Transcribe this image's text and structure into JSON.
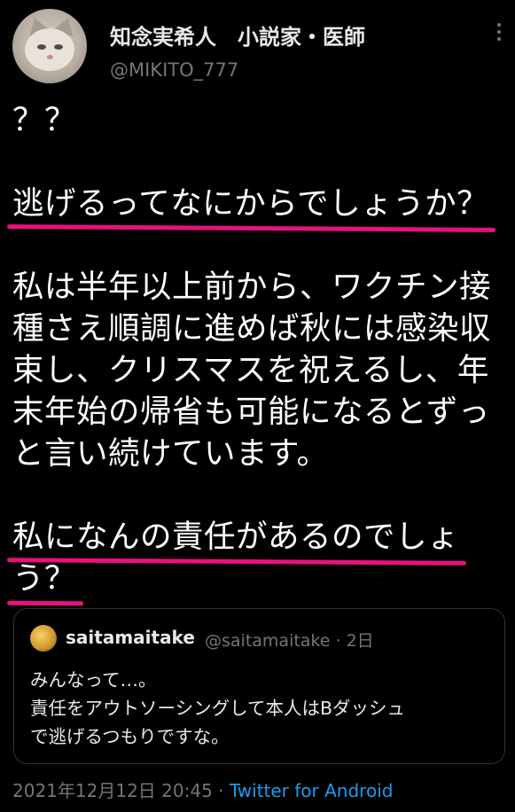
{
  "tweet": {
    "author_name": "知念実希人　小説家・医師",
    "author_handle": "@MIKITO_777",
    "lines": [
      "？？",
      "",
      "逃げるってなにからでしょうか？",
      "",
      "私は半年以上前から、ワクチン接",
      "種さえ順調に進めば秋には感染収",
      "束し、クリスマスを祝えるし、年",
      "末年始の帰省も可能になるとずっ",
      "と言い続けています。",
      "",
      "私になんの責任があるのでしょ",
      "う？"
    ]
  },
  "quote": {
    "author_name": "saitamaitake",
    "author_handle": "@saitamaitake",
    "time": "· 2日",
    "lines": [
      "みんなって…。",
      "責任をアウトソーシングして本人はBダッシュ",
      "で逃げるつもりですな。"
    ]
  },
  "footer": {
    "timestamp": "2021年12月12日 20:45",
    "separator": " · ",
    "source": "Twitter for Android"
  },
  "colors": {
    "underline": "#e8127c",
    "link": "#1d9bf0",
    "muted": "#71767b"
  }
}
